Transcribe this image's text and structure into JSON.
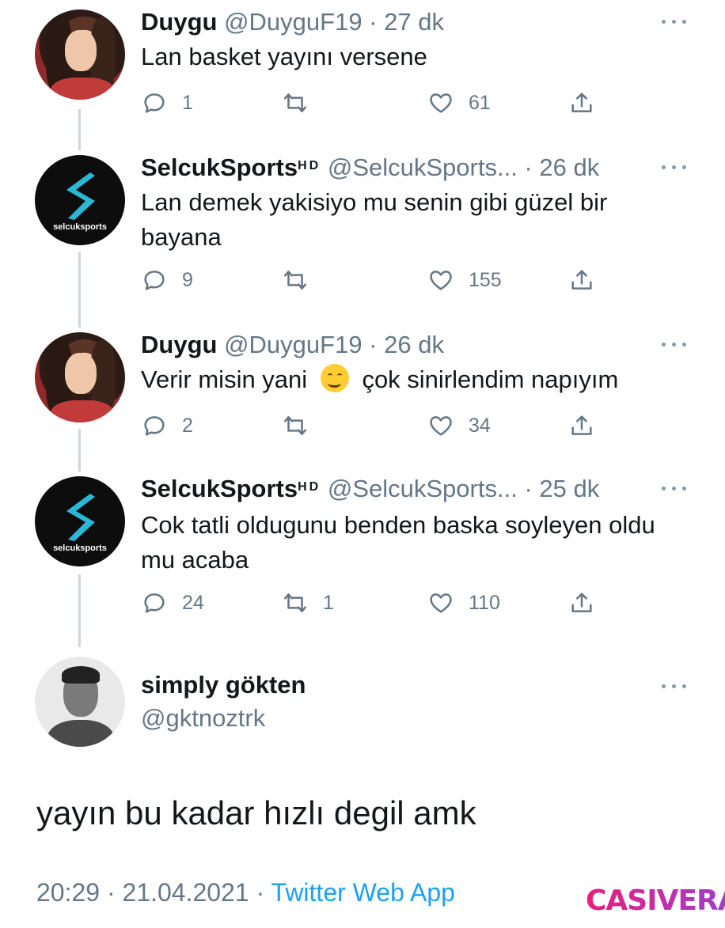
{
  "tweets": [
    {
      "name": "Duygu",
      "name_sup": "",
      "handle": "@DuyguF19",
      "time": "· 27 dk",
      "text": "Lan basket yayını versene",
      "replies": "1",
      "retweets": "",
      "likes": "61"
    },
    {
      "name": "SelcukSports",
      "name_sup": "HD",
      "handle": "@SelcukSports...",
      "time": "· 26 dk",
      "text": "Lan demek yakisiyo mu senin gibi güzel bir bayana",
      "replies": "9",
      "retweets": "",
      "likes": "155"
    },
    {
      "name": "Duygu",
      "name_sup": "",
      "handle": "@DuyguF19",
      "time": "· 26 dk",
      "text_before": "Verir misin yani",
      "emoji": "smiling-face-emoji",
      "text_after": "çok sinirlendim napıyım",
      "replies": "2",
      "retweets": "",
      "likes": "34"
    },
    {
      "name": "SelcukSports",
      "name_sup": "HD",
      "handle": "@SelcukSports...",
      "time": "· 25 dk",
      "text": "Cok tatli oldugunu benden baska soyleyen oldu mu acaba",
      "replies": "24",
      "retweets": "1",
      "likes": "110"
    }
  ],
  "main_tweet": {
    "name": "simply gökten",
    "handle": "@gktnoztrk",
    "text": "yayın bu kadar hızlı degil amk",
    "time": "20:29",
    "date": "· 21.04.2021 ·",
    "app": "Twitter Web App"
  },
  "avatar_logo_text": "selcuksports",
  "watermark": "CASIVERA",
  "colors": {
    "text": "#14171a",
    "muted": "#657786",
    "link": "#1da1f2",
    "thread_line": "#ccd6dd",
    "logo_accent": "#2bb8d6"
  }
}
